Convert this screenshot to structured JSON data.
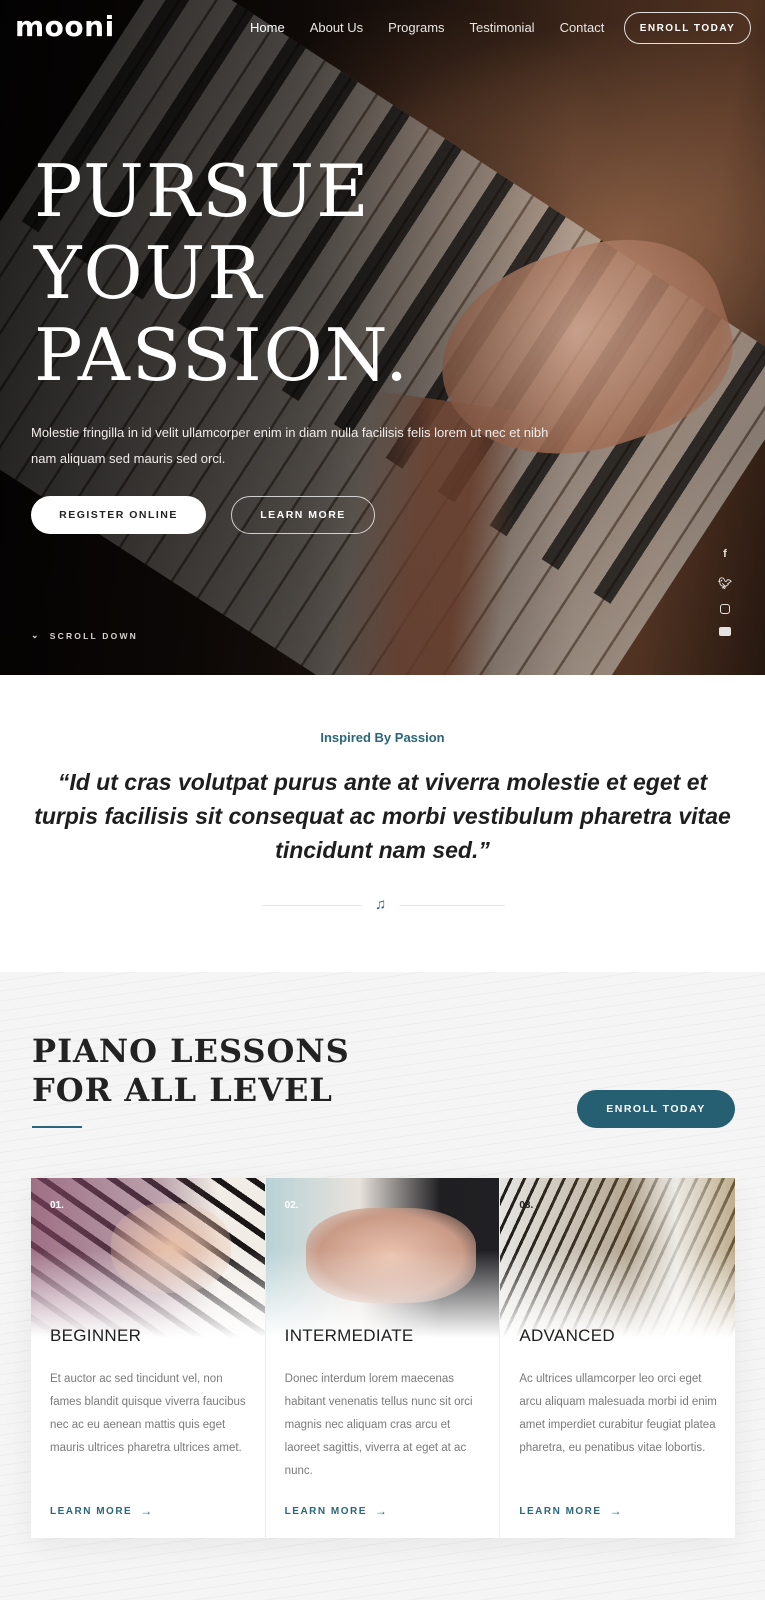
{
  "header": {
    "logo": "mooni",
    "nav": [
      "Home",
      "About Us",
      "Programs",
      "Testimonial",
      "Contact"
    ],
    "enroll_label": "ENROLL TODAY"
  },
  "hero": {
    "title_lines": [
      "PURSUE",
      "YOUR",
      "PASSION."
    ],
    "text": "Molestie fringilla in id velit ullamcorper enim in diam nulla facilisis felis lorem ut nec et nibh nam aliquam sed mauris sed orci.",
    "register_label": "REGISTER ONLINE",
    "learn_label": "LEARN MORE",
    "scroll_label": "SCROLL DOWN",
    "social": [
      "facebook-icon",
      "twitter-icon",
      "instagram-icon",
      "youtube-icon"
    ]
  },
  "intro": {
    "eyebrow": "Inspired By Passion",
    "quote": "“Id ut cras volutpat purus ante at viverra molestie et eget et turpis facilisis sit consequat ac morbi vestibulum pharetra vitae tincidunt nam sed.”"
  },
  "lessons": {
    "title_lines": [
      "PIANO LESSONS",
      "FOR ALL LEVEL"
    ],
    "enroll_label": "ENROLL TODAY",
    "cards": [
      {
        "number": "01.",
        "title": "BEGINNER",
        "description": "Et auctor ac sed tincidunt vel, non fames blandit quisque viverra faucibus nec ac eu aenean mattis quis eget mauris ultrices pharetra ultrices amet.",
        "link": "LEARN MORE"
      },
      {
        "number": "02.",
        "title": "INTERMEDIATE",
        "description": "Donec interdum lorem maecenas habitant venenatis tellus nunc sit orci magnis nec aliquam cras arcu et laoreet sagittis, viverra at eget at ac nunc.",
        "link": "LEARN MORE"
      },
      {
        "number": "03.",
        "title": "ADVANCED",
        "description": "Ac ultrices ullamcorper leo orci eget arcu aliquam malesuada morbi id enim amet imperdiet curabitur feugiat platea pharetra, eu penatibus vitae lobortis.",
        "link": "LEARN MORE"
      }
    ]
  },
  "colors": {
    "accent": "#2a6678",
    "button_dark": "#255f71"
  }
}
